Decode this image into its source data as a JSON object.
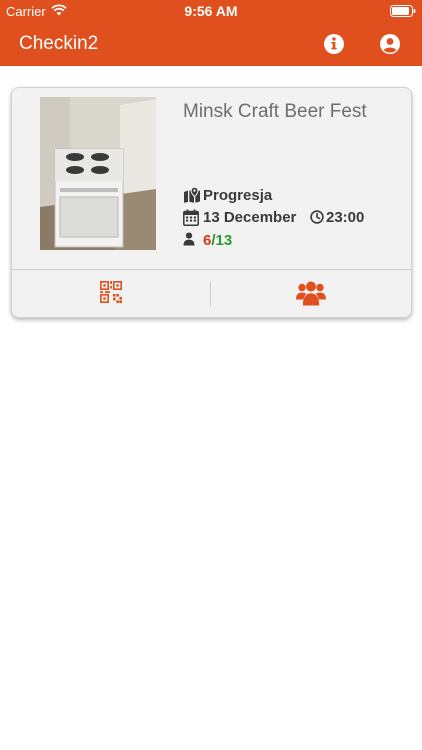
{
  "status_bar": {
    "carrier": "Carrier",
    "time": "9:56 AM"
  },
  "navbar": {
    "title": "Checkin2",
    "info_icon": "info-circle-icon",
    "profile_icon": "user-circle-icon"
  },
  "colors": {
    "brand": "#E0501E",
    "checked_in": "#d33a1a",
    "total": "#2f9a2f"
  },
  "event": {
    "title": "Minsk Craft Beer Fest",
    "venue": "Progresja",
    "date": "13 December",
    "time": "23:00",
    "checked_in": "6",
    "separator": "/",
    "total": "13",
    "actions": {
      "scan_icon": "qr-code-icon",
      "attendees_icon": "users-icon"
    }
  }
}
